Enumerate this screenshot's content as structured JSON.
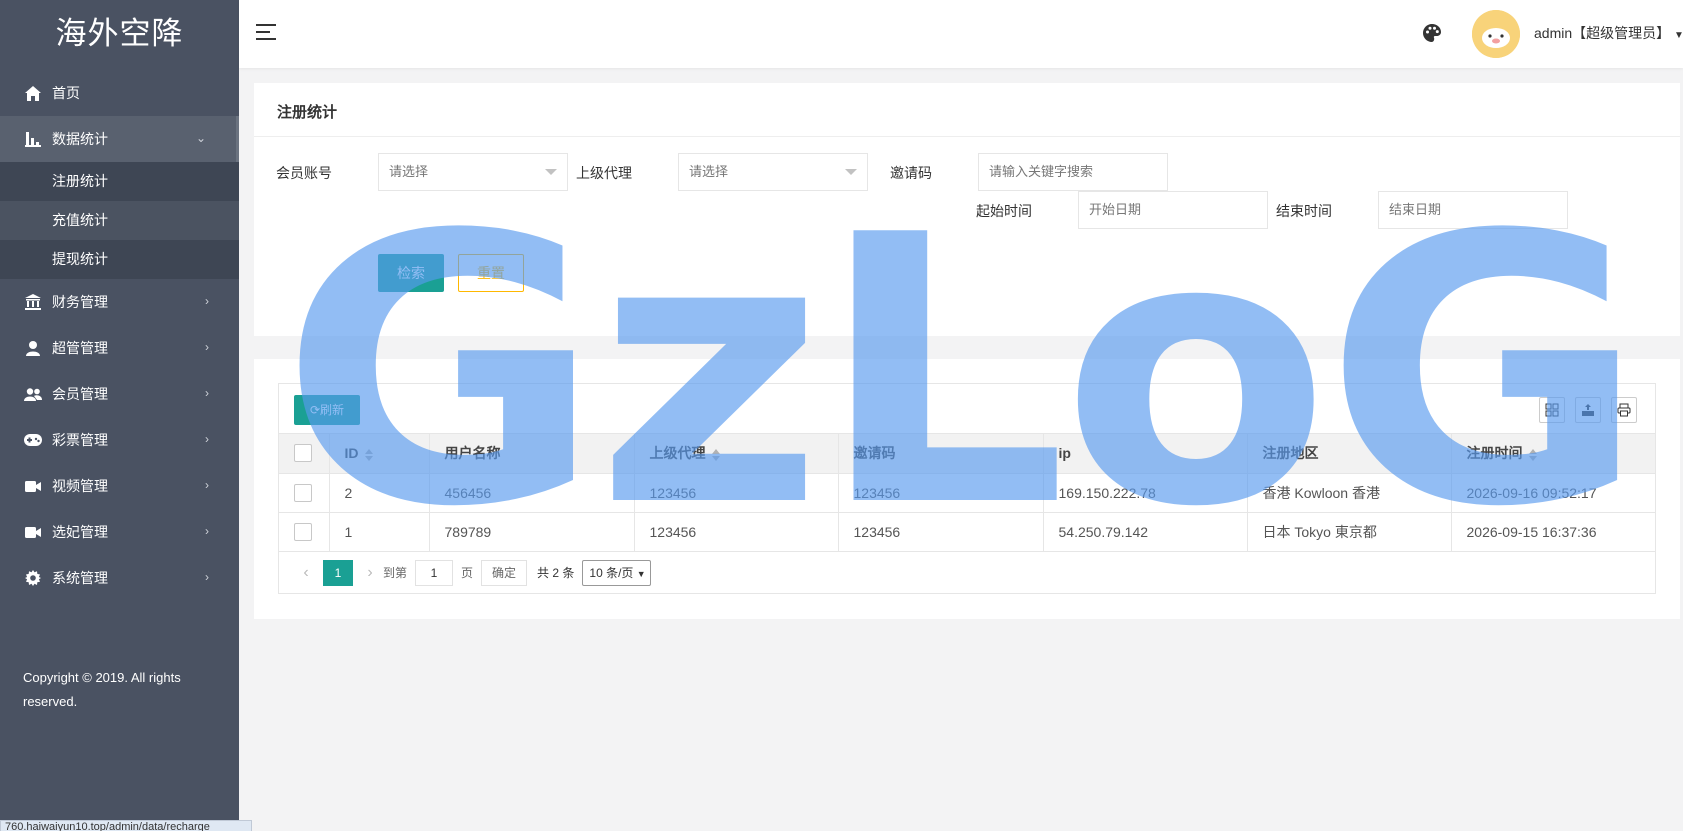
{
  "app": {
    "brand": "海外空降",
    "user_label": "admin【超级管理员】"
  },
  "sidebar": {
    "items": [
      {
        "label": "首页",
        "icon": "home-icon"
      },
      {
        "label": "数据统计",
        "icon": "bar-chart-icon",
        "expanded": true,
        "children": [
          {
            "label": "注册统计"
          },
          {
            "label": "充值统计"
          },
          {
            "label": "提现统计"
          }
        ]
      },
      {
        "label": "财务管理",
        "icon": "bank-icon"
      },
      {
        "label": "超管管理",
        "icon": "user-icon"
      },
      {
        "label": "会员管理",
        "icon": "users-icon"
      },
      {
        "label": "彩票管理",
        "icon": "gamepad-icon"
      },
      {
        "label": "视频管理",
        "icon": "video-camera-icon"
      },
      {
        "label": "选妃管理",
        "icon": "video-camera-icon"
      },
      {
        "label": "系统管理",
        "icon": "gear-icon"
      }
    ],
    "copyright": "Copyright © 2019. All rights reserved.",
    "status_url": "760.haiwaiyun10.top/admin/data/recharge"
  },
  "filter": {
    "title": "注册统计",
    "member_label": "会员账号",
    "member_placeholder": "请选择",
    "agent_label": "上级代理",
    "agent_placeholder": "请选择",
    "invite_label": "邀请码",
    "invite_placeholder": "请输入关键字搜索",
    "start_label": "起始时间",
    "start_placeholder": "开始日期",
    "end_label": "结束时间",
    "end_placeholder": "结束日期",
    "search_button": "检索",
    "reset_button": "重置"
  },
  "table": {
    "refresh_button": "刷新",
    "columns": [
      "ID",
      "用户名称",
      "上级代理",
      "邀请码",
      "ip",
      "注册地区",
      "注册时间"
    ],
    "rows": [
      {
        "id": "2",
        "username": "456456",
        "agent": "123456",
        "invite": "123456",
        "ip": "169.150.222.78",
        "region": "香港 Kowloon 香港",
        "time": "2026-09-16 09:52:17"
      },
      {
        "id": "1",
        "username": "789789",
        "agent": "123456",
        "invite": "123456",
        "ip": "54.250.79.142",
        "region": "日本 Tokyo 東京都",
        "time": "2026-09-15 16:37:36"
      }
    ],
    "pager": {
      "current": "1",
      "goto_label": "到第",
      "page_input": "1",
      "page_suffix": "页",
      "confirm": "确定",
      "total": "共 2 条",
      "size": "10 条/页"
    }
  },
  "watermark": "GzLoG",
  "colors": {
    "sidebar_bg": "#4a5262",
    "primary": "#1aa094",
    "warn": "#ffb800",
    "watermark": "#5899ee"
  }
}
